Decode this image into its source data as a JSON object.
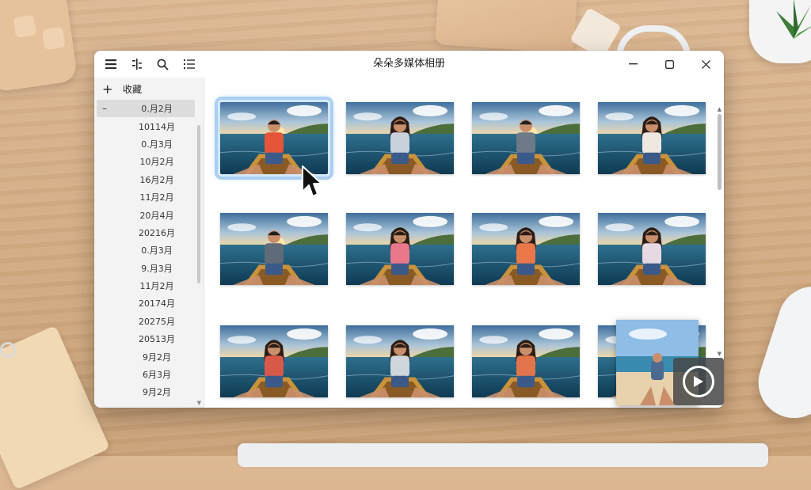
{
  "window": {
    "title": "朵朵多媒体相册"
  },
  "toolbar": {
    "icons": [
      "menu-icon",
      "timeline-icon",
      "search-icon",
      "list-icon"
    ]
  },
  "window_controls": [
    "minimize-icon",
    "maximize-icon",
    "close-icon"
  ],
  "sidebar": {
    "header": {
      "icon": "+",
      "label": "收藏"
    },
    "selected_prefix": "–",
    "items": [
      {
        "label": "0.月2月",
        "selected": true
      },
      {
        "label": "10114月"
      },
      {
        "label": "0.月3月"
      },
      {
        "label": "10月2月"
      },
      {
        "label": "16月2月"
      },
      {
        "label": "11月2月"
      },
      {
        "label": "20月4月"
      },
      {
        "label": "20216月"
      },
      {
        "label": "0.月3月"
      },
      {
        "label": "9.月3月"
      },
      {
        "label": "11月2月"
      },
      {
        "label": "20174月"
      },
      {
        "label": "20275月"
      },
      {
        "label": "20513月"
      },
      {
        "label": "9月2月"
      },
      {
        "label": "6月3月"
      },
      {
        "label": "9月2月"
      }
    ]
  },
  "photos": [
    {
      "scene": "sunset",
      "person": "man",
      "shirt": "#e4553a",
      "selected": true
    },
    {
      "scene": "day",
      "person": "woman",
      "shirt": "#c9d1dc"
    },
    {
      "scene": "sunset",
      "person": "man",
      "shirt": "#6e7a87"
    },
    {
      "scene": "day",
      "person": "woman",
      "shirt": "#efe8e0"
    },
    {
      "scene": "sunset",
      "person": "man",
      "shirt": "#5f6b78"
    },
    {
      "scene": "day",
      "person": "woman",
      "shirt": "#e8788a"
    },
    {
      "scene": "day",
      "person": "woman",
      "shirt": "#e9774a"
    },
    {
      "scene": "day",
      "person": "woman",
      "shirt": "#e7d9e3"
    },
    {
      "scene": "day",
      "person": "woman",
      "shirt": "#d8584a"
    },
    {
      "scene": "day",
      "person": "woman",
      "shirt": "#cfd6dc"
    },
    {
      "scene": "day",
      "person": "woman",
      "shirt": "#e2744c"
    },
    {
      "scene": "day",
      "person": "woman",
      "shirt": "#dcdcdc"
    }
  ],
  "video": {
    "icon": "play-icon"
  }
}
